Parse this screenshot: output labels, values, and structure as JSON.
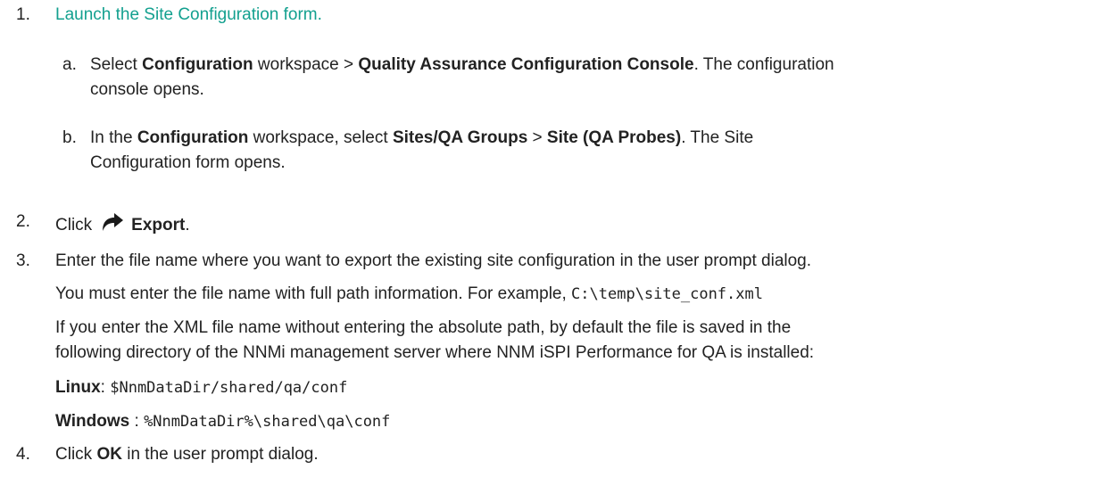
{
  "steps": {
    "s1": {
      "num": "1.",
      "link": "Launch the Site Configuration form."
    },
    "s1a": {
      "num": "a.",
      "t1": "Select ",
      "b1": "Configuration",
      "t2": " workspace > ",
      "b2": "Quality Assurance Configuration Console",
      "t3": ". The configuration",
      "l2": "console opens."
    },
    "s1b": {
      "num": "b.",
      "t1": "In the ",
      "b1": "Configuration",
      "t2": " workspace, select ",
      "b2": "Sites/QA Groups",
      "t3": " > ",
      "b3": "Site (QA Probes)",
      "t4": ". The Site",
      "l2": "Configuration form opens."
    },
    "s2": {
      "num": "2.",
      "t1": "Click",
      "icon": "export-arrow-icon",
      "b1": "Export",
      "t2": "."
    },
    "s3": {
      "num": "3.",
      "line1": "Enter the file name where you want to export the existing site configuration in the user prompt dialog.",
      "p1": "You must enter the file name with full path information. For example, ",
      "p1_code": "C:\\temp\\site_conf.xml",
      "p2a": "If you enter the XML file name without entering the absolute path, by default the file is saved in the",
      "p2b": "following directory of the NNMi management server where NNM iSPI Performance for QA is installed:",
      "linux_label": "Linux",
      "linux_sep": ": ",
      "linux_path": "$NnmDataDir/shared/qa/conf",
      "windows_label": "Windows",
      "windows_sep": " : ",
      "windows_path": "%NnmDataDir%\\shared\\qa\\conf"
    },
    "s4": {
      "num": "4.",
      "t1": "Click ",
      "b1": "OK",
      "t2": " in the user prompt dialog."
    }
  },
  "colors": {
    "link": "#13a08f",
    "text": "#222222"
  }
}
